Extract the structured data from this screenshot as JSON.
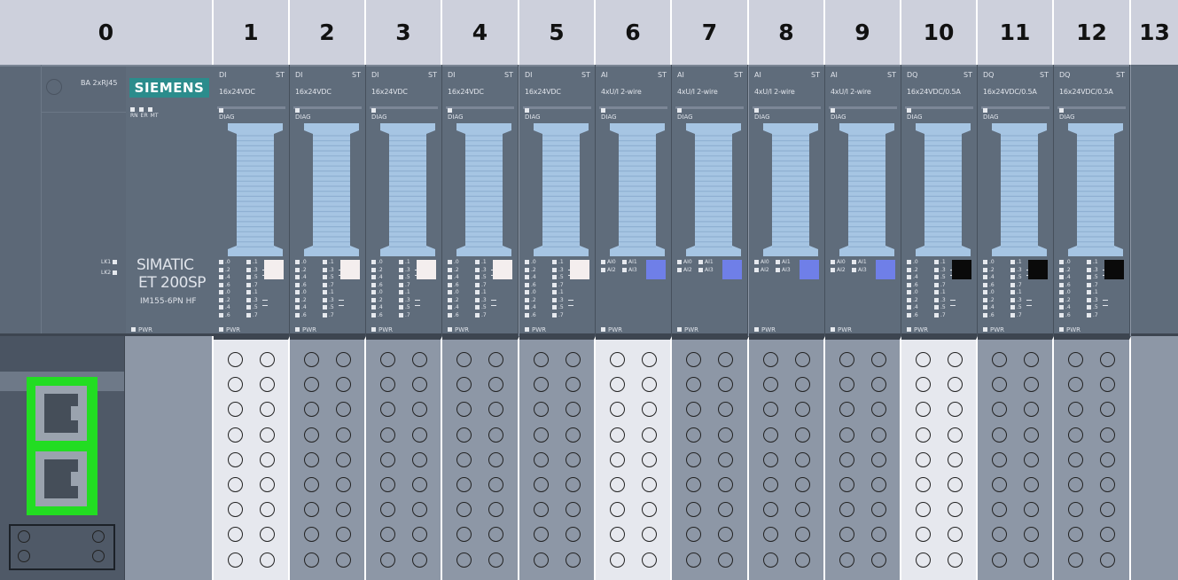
{
  "header": {
    "slots": [
      "0",
      "1",
      "2",
      "3",
      "4",
      "5",
      "6",
      "7",
      "8",
      "9",
      "10",
      "11",
      "12",
      "13"
    ]
  },
  "interface_module": {
    "label": "BA 2xRJ45",
    "led_lk1": "LK1",
    "led_lk2": "LK2",
    "port_count": 2
  },
  "head_module": {
    "brand": "SIEMENS",
    "led_rn": "RN",
    "led_er": "ER",
    "led_mt": "MT",
    "product_line1": "SIMATIC",
    "product_line2": "ET 200SP",
    "article": "IM155-6PN HF",
    "pwr": "PWR"
  },
  "modules": [
    {
      "slot": "1",
      "type": "DI",
      "st": "ST",
      "part": "16x24VDC",
      "diag": "DIAG",
      "pwr": "PWR",
      "kind": "digital",
      "status_color": "#f4eeee",
      "terminal": "#e6e8ee"
    },
    {
      "slot": "2",
      "type": "DI",
      "st": "ST",
      "part": "16x24VDC",
      "diag": "DIAG",
      "pwr": "PWR",
      "kind": "digital",
      "status_color": "#f4eeee",
      "terminal": "#8d97a6"
    },
    {
      "slot": "3",
      "type": "DI",
      "st": "ST",
      "part": "16x24VDC",
      "diag": "DIAG",
      "pwr": "PWR",
      "kind": "digital",
      "status_color": "#f4eeee",
      "terminal": "#8d97a6"
    },
    {
      "slot": "4",
      "type": "DI",
      "st": "ST",
      "part": "16x24VDC",
      "diag": "DIAG",
      "pwr": "PWR",
      "kind": "digital",
      "status_color": "#f4eeee",
      "terminal": "#8d97a6"
    },
    {
      "slot": "5",
      "type": "DI",
      "st": "ST",
      "part": "16x24VDC",
      "diag": "DIAG",
      "pwr": "PWR",
      "kind": "digital",
      "status_color": "#f4eeee",
      "terminal": "#8d97a6"
    },
    {
      "slot": "6",
      "type": "AI",
      "st": "ST",
      "part": "4xU/I 2-wire",
      "diag": "DIAG",
      "pwr": "PWR",
      "kind": "analog",
      "status_color": "#6f7fe8",
      "terminal": "#e6e8ee"
    },
    {
      "slot": "7",
      "type": "AI",
      "st": "ST",
      "part": "4xU/I 2-wire",
      "diag": "DIAG",
      "pwr": "PWR",
      "kind": "analog",
      "status_color": "#6f7fe8",
      "terminal": "#8d97a6"
    },
    {
      "slot": "8",
      "type": "AI",
      "st": "ST",
      "part": "4xU/I 2-wire",
      "diag": "DIAG",
      "pwr": "PWR",
      "kind": "analog",
      "status_color": "#6f7fe8",
      "terminal": "#8d97a6"
    },
    {
      "slot": "9",
      "type": "AI",
      "st": "ST",
      "part": "4xU/I 2-wire",
      "diag": "DIAG",
      "pwr": "PWR",
      "kind": "analog",
      "status_color": "#6f7fe8",
      "terminal": "#8d97a6"
    },
    {
      "slot": "10",
      "type": "DQ",
      "st": "ST",
      "part": "16x24VDC/0.5A",
      "diag": "DIAG",
      "pwr": "PWR",
      "kind": "digital",
      "status_color": "#0a0a0a",
      "terminal": "#e6e8ee"
    },
    {
      "slot": "11",
      "type": "DQ",
      "st": "ST",
      "part": "16x24VDC/0.5A",
      "diag": "DIAG",
      "pwr": "PWR",
      "kind": "digital",
      "status_color": "#0a0a0a",
      "terminal": "#8d97a6"
    },
    {
      "slot": "12",
      "type": "DQ",
      "st": "ST",
      "part": "16x24VDC/0.5A",
      "diag": "DIAG",
      "pwr": "PWR",
      "kind": "digital",
      "status_color": "#0a0a0a",
      "terminal": "#8d97a6"
    }
  ],
  "digital_led_labels": {
    "col1": [
      ".0",
      ".2",
      ".4",
      ".6",
      ".0",
      ".2",
      ".4",
      ".6"
    ],
    "col2": [
      ".1",
      ".3",
      ".5",
      ".7",
      ".1",
      ".3",
      ".5",
      ".7"
    ]
  },
  "analog_led_labels": [
    "AI0",
    "AI1",
    "AI2",
    "AI3"
  ],
  "colors": {
    "header_bg": "#cdd0dc",
    "module_body": "#5f6c7b",
    "connector": "#a6c5e3",
    "port_highlight": "#22dd22",
    "siemens_teal": "#2b8c8c"
  }
}
